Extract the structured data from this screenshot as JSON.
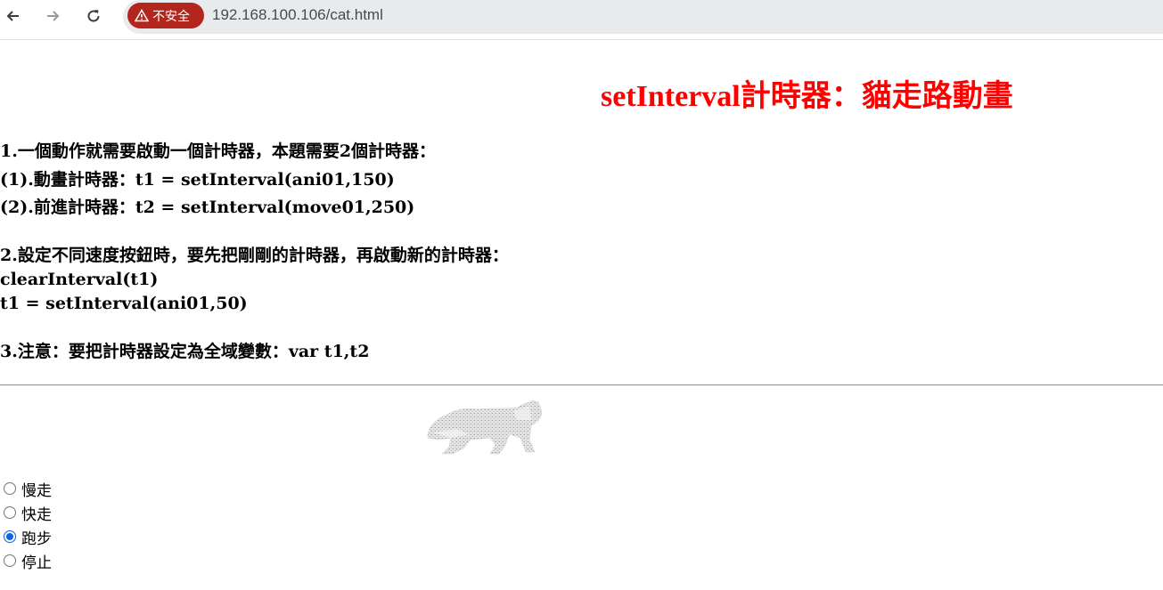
{
  "browser": {
    "security_chip": "不安全",
    "url": "192.168.100.106/cat.html"
  },
  "page": {
    "title": "setInterval計時器：貓走路動畫",
    "lines": [
      "1.一個動作就需要啟動一個計時器，本題需要2個計時器：",
      "(1).動畫計時器：t1 = setInterval(ani01,150)",
      "(2).前進計時器：t2 = setInterval(move01,250)",
      "2.設定不同速度按鈕時，要先把剛剛的計時器，再啟動新的計時器：",
      "clearInterval(t1)",
      "t1 = setInterval(ani01,50)",
      "3.注意：要把計時器設定為全域變數：var t1,t2"
    ],
    "speed_options": [
      {
        "label": "慢走",
        "checked": false
      },
      {
        "label": "快走",
        "checked": false
      },
      {
        "label": "跑步",
        "checked": true
      },
      {
        "label": "停止",
        "checked": false
      }
    ]
  },
  "colors": {
    "title": "#ff0000",
    "chip": "#b3261e",
    "radio_checked": "#0b66e4"
  }
}
